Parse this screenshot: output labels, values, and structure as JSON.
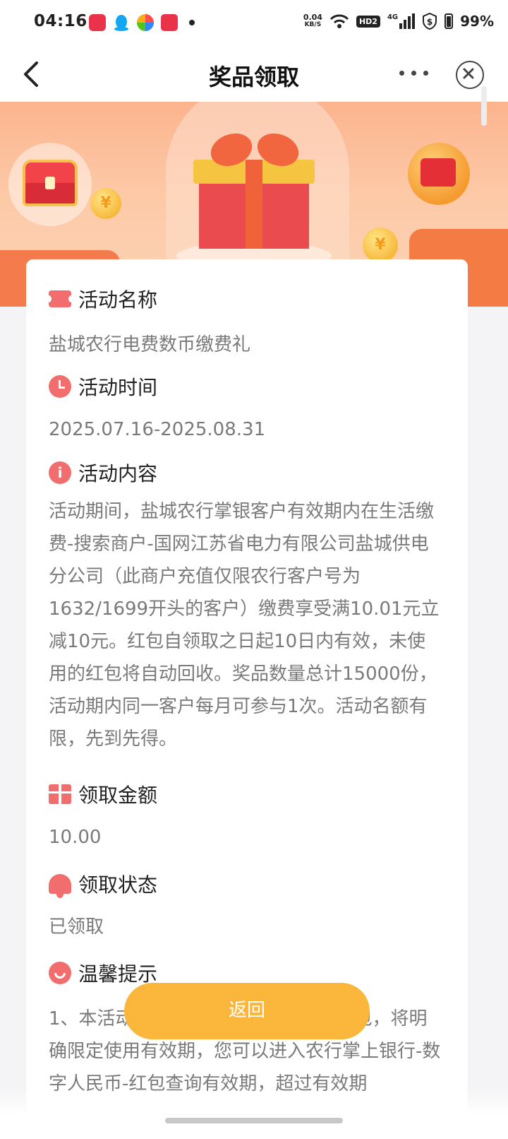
{
  "status_bar": {
    "time": "04:16",
    "net_speed": "0.04",
    "net_unit": "KB/S",
    "hd_badge": "HD2",
    "signal": "4G",
    "battery": "99%",
    "icons": [
      "music-app-icon",
      "qq-icon",
      "pinwheel-app-icon",
      "news-app-icon",
      "wifi-icon",
      "signal-icon",
      "shield-icon",
      "battery-icon"
    ]
  },
  "header": {
    "title": "奖品领取",
    "back_icon": "chevron-left-icon",
    "more_icon": "more-dots-icon",
    "close_icon": "close-circle-icon"
  },
  "banner": {
    "coin_symbol": "¥"
  },
  "sections": {
    "name": {
      "title": "活动名称",
      "icon": "ticket-icon",
      "body": "盐城农行电费数币缴费礼"
    },
    "time": {
      "title": "活动时间",
      "icon": "clock-icon",
      "body": "2025.07.16-2025.08.31"
    },
    "content": {
      "title": "活动内容",
      "icon": "info-icon",
      "icon_glyph": "i",
      "body": "活动期间，盐城农行掌银客户有效期内在生活缴费-搜索商户-国网江苏省电力有限公司盐城供电分公司（此商户充值仅限农行客户号为1632/1699开头的客户）缴费享受满10.01元立减10元。红包自领取之日起10日内有效，未使用的红包将自动回收。奖品数量总计15000份，活动期内同一客户每月可参与1次。活动名额有限，先到先得。"
    },
    "amount": {
      "title": "领取金额",
      "icon": "gift-icon",
      "body": "10.00"
    },
    "status": {
      "title": "领取状态",
      "icon": "bell-icon",
      "body": "已领取"
    },
    "tips": {
      "title": "温馨提示",
      "icon": "smile-icon",
      "body": "1、本活动领取的奖品为数字人民币红包，将明确限定使用有效期，您可以进入农行掌上银行-数字人民币-红包查询有效期，超过有效期"
    }
  },
  "return_button": {
    "label": "返回"
  },
  "colors": {
    "accent": "#f26d6d",
    "button": "#fbb73c",
    "banner": "#fbb48e"
  }
}
